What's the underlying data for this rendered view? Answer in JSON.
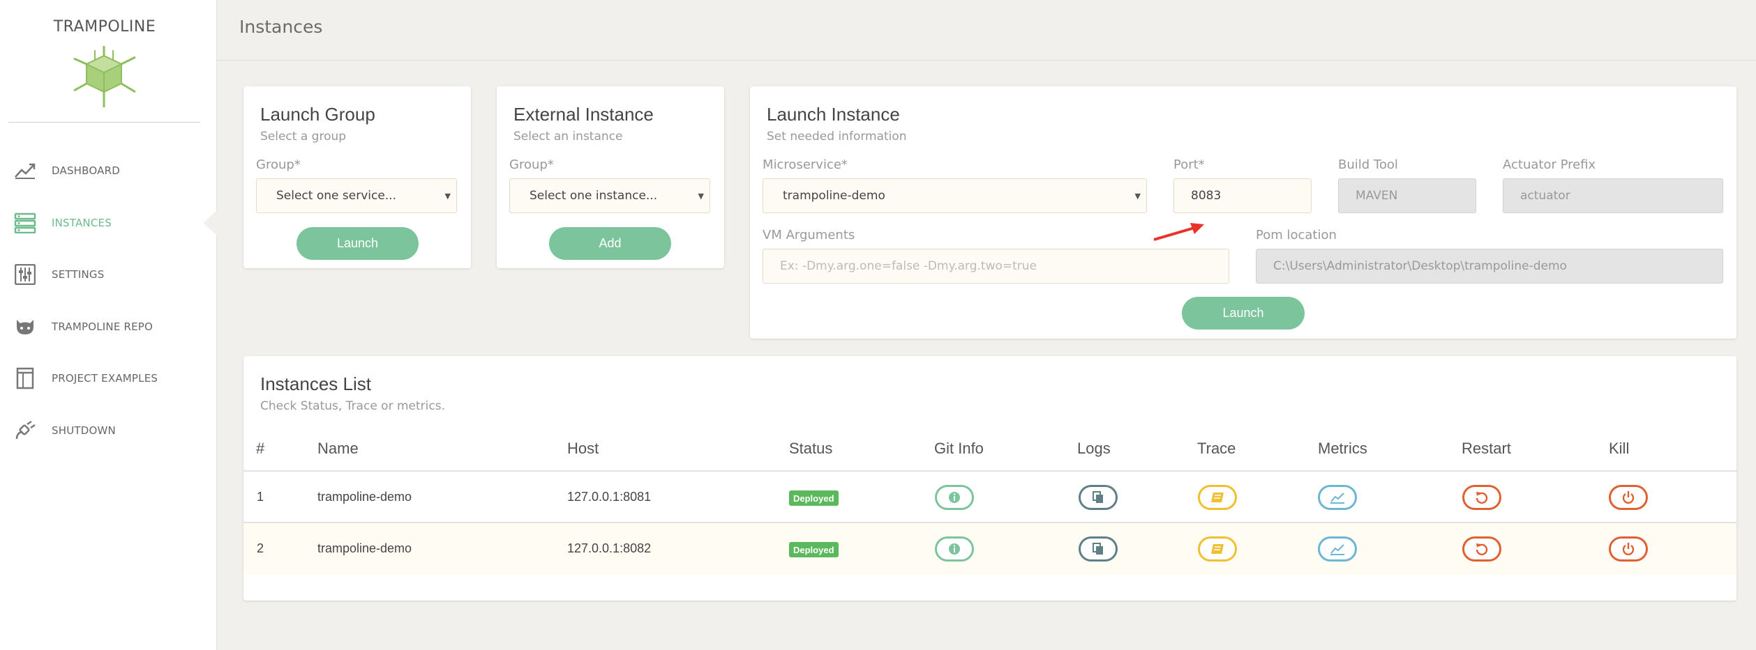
{
  "app": {
    "brand": "TRAMPOLINE"
  },
  "sidebar": {
    "items": [
      {
        "label": "DASHBOARD",
        "icon": "chart-line-icon",
        "active": false
      },
      {
        "label": "INSTANCES",
        "icon": "server-list-icon",
        "active": true
      },
      {
        "label": "SETTINGS",
        "icon": "sliders-icon",
        "active": false
      },
      {
        "label": "TRAMPOLINE REPO",
        "icon": "github-icon",
        "active": false
      },
      {
        "label": "PROJECT EXAMPLES",
        "icon": "book-icon",
        "active": false
      },
      {
        "label": "SHUTDOWN",
        "icon": "unplug-icon",
        "active": false
      }
    ]
  },
  "header": {
    "title": "Instances"
  },
  "launch_group": {
    "title": "Launch Group",
    "subtitle": "Select a group",
    "group_label": "Group*",
    "group_value": "Select one service...",
    "button": "Launch"
  },
  "external_instance": {
    "title": "External Instance",
    "subtitle": "Select an instance",
    "group_label": "Group*",
    "group_value": "Select one instance...",
    "button": "Add"
  },
  "launch_instance": {
    "title": "Launch Instance",
    "subtitle": "Set needed information",
    "microservice_label": "Microservice*",
    "microservice_value": "trampoline-demo",
    "port_label": "Port*",
    "port_value": "8083",
    "build_tool_label": "Build Tool",
    "build_tool_value": "MAVEN",
    "actuator_label": "Actuator Prefix",
    "actuator_value": "actuator",
    "vm_label": "VM Arguments",
    "vm_placeholder": "Ex: -Dmy.arg.one=false -Dmy.arg.two=true",
    "pom_label": "Pom location",
    "pom_value": "C:\\Users\\Administrator\\Desktop\\trampoline-demo",
    "button": "Launch"
  },
  "instances_list": {
    "title": "Instances List",
    "subtitle": "Check Status, Trace or metrics.",
    "columns": [
      "#",
      "Name",
      "Host",
      "Status",
      "Git Info",
      "Logs",
      "Trace",
      "Metrics",
      "Restart",
      "Kill"
    ],
    "rows": [
      {
        "index": "1",
        "name": "trampoline-demo",
        "host": "127.0.0.1:8081",
        "status": "Deployed"
      },
      {
        "index": "2",
        "name": "trampoline-demo",
        "host": "127.0.0.1:8082",
        "status": "Deployed"
      }
    ]
  },
  "colors": {
    "accent_green": "#7cc49c",
    "active_nav": "#6dba8d",
    "deployed_badge": "#5cb85c",
    "git_info": "#7cc49c",
    "logs": "#5f7f86",
    "trace": "#f0c030",
    "metrics": "#6bb6d2",
    "restart": "#e06030",
    "kill": "#e06030",
    "annotation_arrow": "#e8322a"
  }
}
